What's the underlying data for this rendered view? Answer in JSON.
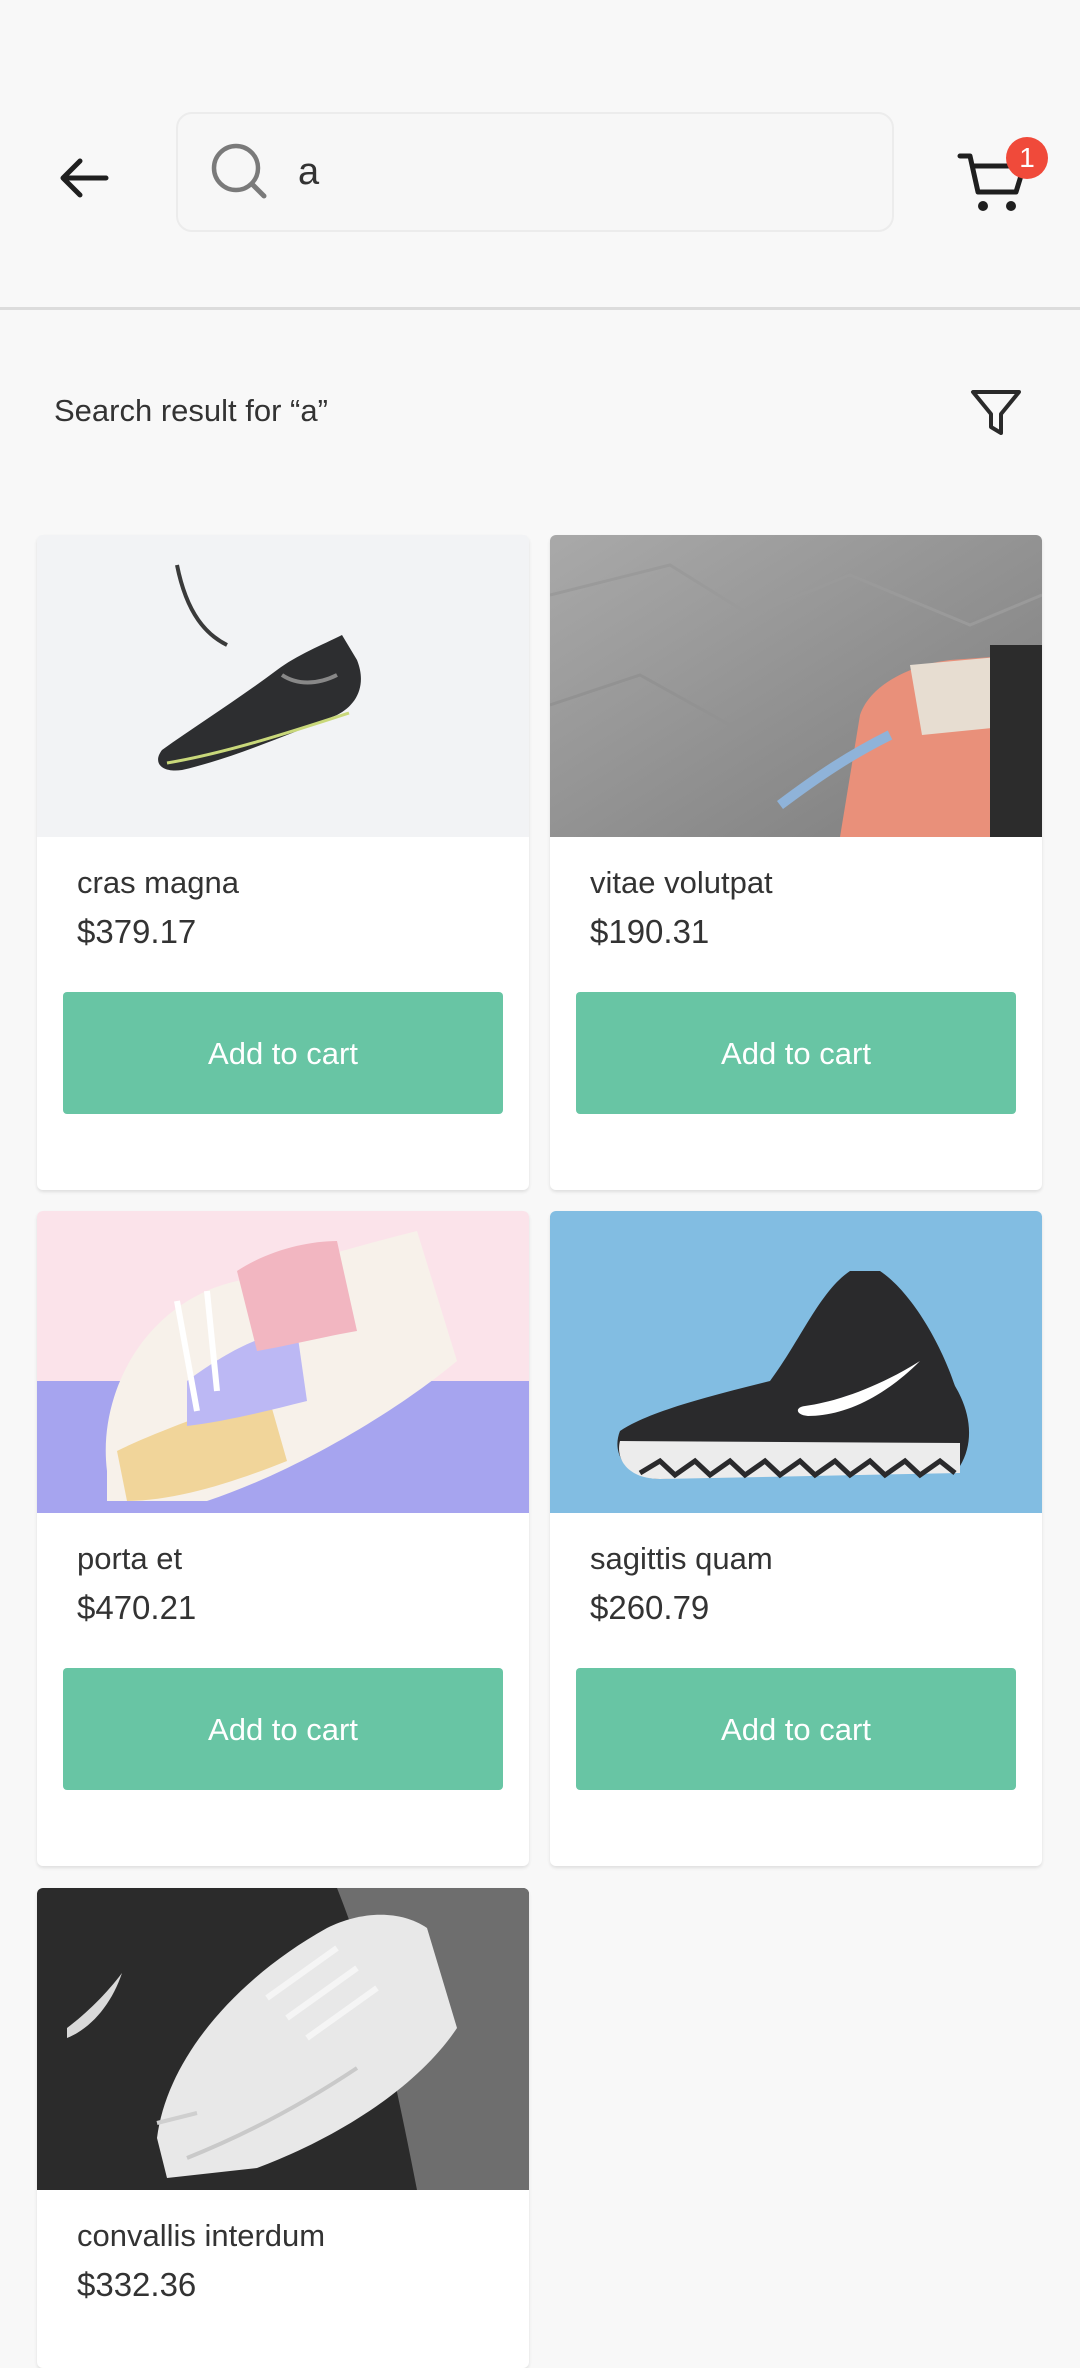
{
  "header": {
    "search_value": "a",
    "cart_count": "1"
  },
  "results": {
    "label": "Search result for “a”"
  },
  "products": [
    {
      "name": "cras magna",
      "price": "$379.17",
      "button": "Add to cart"
    },
    {
      "name": "vitae volutpat",
      "price": "$190.31",
      "button": "Add to cart"
    },
    {
      "name": "porta et",
      "price": "$470.21",
      "button": "Add to cart"
    },
    {
      "name": "sagittis quam",
      "price": "$260.79",
      "button": "Add to cart"
    },
    {
      "name": "convallis interdum",
      "price": "$332.36"
    }
  ],
  "icons": {
    "back": "arrow-left-icon",
    "search": "search-icon",
    "cart": "cart-icon",
    "filter": "filter-icon"
  },
  "colors": {
    "accent": "#68c5a4",
    "badge": "#f04a3a",
    "background": "#f8f8f8"
  }
}
